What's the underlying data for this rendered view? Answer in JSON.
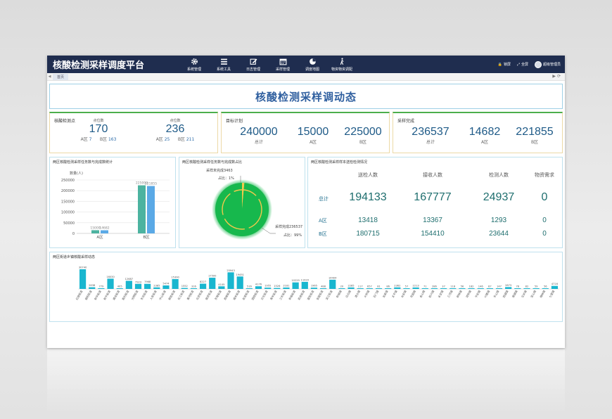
{
  "app": {
    "title": "核酸检测采样调度平台"
  },
  "nav": [
    {
      "label": "系统管理",
      "icon": "gear-icon"
    },
    {
      "label": "系统工具",
      "icon": "menu-icon"
    },
    {
      "label": "日志管理",
      "icon": "edit-icon"
    },
    {
      "label": "采样管理",
      "icon": "calendar-icon"
    },
    {
      "label": "调度地图",
      "icon": "pie-chart-icon"
    },
    {
      "label": "物资物资调配",
      "icon": "walking-person-icon"
    }
  ],
  "top_right": {
    "lock": "锁屏",
    "fullscreen": "全屏",
    "user": "超级管理员"
  },
  "tabs": {
    "home": "首页"
  },
  "banner": {
    "title": "核酸检测采样调动态"
  },
  "kpi1": {
    "label": "核酸检测点",
    "left_caption": "点位数",
    "left_value": "170",
    "left_a_label": "A区",
    "left_a_value": "7",
    "left_b_label": "B区",
    "left_b_value": "163",
    "right_caption": "点位数",
    "right_value": "236",
    "right_a_label": "A区",
    "right_a_value": "25",
    "right_b_label": "B区",
    "right_b_value": "211"
  },
  "kpi2": {
    "label": "目标计划",
    "total_value": "240000",
    "total_caption": "总计",
    "a_value": "15000",
    "a_caption": "A区",
    "b_value": "225000",
    "b_caption": "B区"
  },
  "kpi3": {
    "label": "采样完成",
    "total_value": "236537",
    "total_caption": "总计",
    "a_value": "14682",
    "a_caption": "A区",
    "b_value": "221855",
    "b_caption": "B区"
  },
  "panel_bar": {
    "title": "两区核酸检测采样任务数与完成数统计"
  },
  "panel_pie": {
    "title": "两区核酸检测采样任务数与完成数占比"
  },
  "panel_stats": {
    "title": "两区核酸检测采样样本送检检测情况",
    "headers": [
      "送检人数",
      "接收人数",
      "检测人数",
      "物资需求"
    ],
    "rows": [
      {
        "label": "总计",
        "values": [
          "194133",
          "167777",
          "24937",
          "0"
        ]
      },
      {
        "label": "A区",
        "values": [
          "13418",
          "13367",
          "1293",
          "0"
        ]
      },
      {
        "label": "B区",
        "values": [
          "180715",
          "154410",
          "23644",
          "0"
        ]
      }
    ]
  },
  "panel_area": {
    "title": "两区街道乡镇核酸采样动态"
  },
  "chart_data": [
    {
      "type": "bar",
      "title": "两区核酸检测采样任务数与完成数统计",
      "ylabel": "数量(人)",
      "categories": [
        "A区",
        "B区"
      ],
      "series": [
        {
          "values": [
            15000,
            225000
          ],
          "color": "#4cb3a0"
        },
        {
          "values": [
            14682,
            221855
          ],
          "color": "#5aa9e6"
        }
      ],
      "ylim": [
        0,
        250000
      ],
      "yticks": [
        "0",
        "50000",
        "100000",
        "150000",
        "200000",
        "250000"
      ],
      "grid": true
    },
    {
      "type": "pie",
      "title": "两区核酸检测采样任务数与完成数占比",
      "slices": [
        {
          "label": "采样未完成",
          "value": 3463,
          "percent_label": "占比：1%",
          "color": "#f2c94c"
        },
        {
          "label": "采样完成",
          "value": 236537,
          "percent_label": "占比：99%",
          "color": "#17b84d"
        }
      ],
      "slice_captions": [
        "采样未完成3463",
        "采样完成236537"
      ]
    },
    {
      "type": "bar",
      "title": "两区街道乡镇核酸采样动态",
      "values": [
        30740,
        2638,
        779,
        16030,
        405,
        12687,
        7923,
        7968,
        2385,
        5474,
        15390,
        1552,
        316,
        8227,
        17500,
        4105,
        25943,
        19451,
        516,
        4176,
        1955,
        1526,
        2181,
        10229,
        11020,
        1965,
        488,
        14404,
        20,
        2285,
        117,
        657,
        81,
        86,
        2362,
        57,
        2213,
        71,
        286,
        37,
        118,
        56,
        182,
        146,
        87,
        147,
        2873,
        78,
        82,
        59,
        56,
        4716
      ],
      "categories": [
        "红旗街道",
        "朝阳街道",
        "新华街道",
        "和平街道",
        "建设街道",
        "胜利街道",
        "光明街道",
        "东风街道",
        "人民街道",
        "中山街道",
        "解放街道",
        "长江街道",
        "黄河街道",
        "北京街道",
        "南京街道",
        "东城街道",
        "西城街道",
        "城关街道",
        "友谊街道",
        "团结街道",
        "文化街道",
        "青年街道",
        "工农街道",
        "幸福街道",
        "前进街道",
        "富民街道",
        "安居街道",
        "滨江街道",
        "新城镇",
        "白云镇",
        "清水镇",
        "大桥镇",
        "石门镇",
        "龙泉镇",
        "太平镇",
        "长安镇",
        "花园镇",
        "金山镇",
        "新兴镇",
        "永安镇",
        "三河镇",
        "柳林镇",
        "双桥镇",
        "平安镇",
        "兴隆镇",
        "东山镇",
        "西湖镇",
        "南湖镇",
        "北关镇",
        "宝山镇",
        "梅林镇",
        "七里镇"
      ],
      "color": "#19b6cf"
    }
  ]
}
